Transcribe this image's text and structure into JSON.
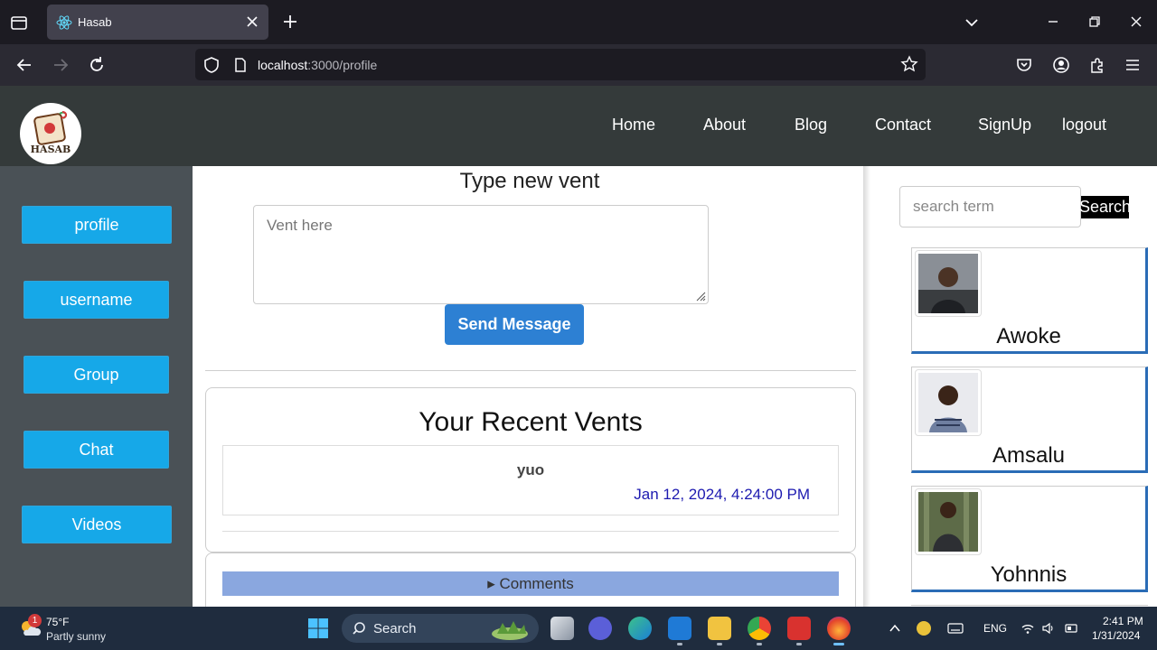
{
  "browser": {
    "tab_title": "Hasab",
    "url_host": "localhost",
    "url_path": ":3000/profile"
  },
  "site": {
    "logo_text": "HASAB",
    "nav": [
      "Home",
      "About",
      "Blog",
      "Contact",
      "SignUp",
      "logout"
    ]
  },
  "sidebar": {
    "items": [
      "profile",
      "username",
      "Group",
      "Chat",
      "Videos"
    ]
  },
  "vent_form": {
    "heading": "Type new vent",
    "placeholder": "Vent here",
    "send_label": "Send Message"
  },
  "recent": {
    "title": "Your Recent Vents",
    "vents": [
      {
        "text": "yuo",
        "date": "Jan 12, 2024, 4:24:00 PM"
      }
    ],
    "comments_label": "▸ Comments"
  },
  "search": {
    "placeholder": "search term",
    "button_label": "Search"
  },
  "users": [
    {
      "name": "Awoke"
    },
    {
      "name": "Amsalu"
    },
    {
      "name": "Yohnnis"
    }
  ],
  "taskbar": {
    "weather_temp": "75°F",
    "weather_desc": "Partly sunny",
    "weather_badge": "1",
    "search_label": "Search",
    "lang": "ENG",
    "time": "2:41 PM",
    "date": "1/31/2024"
  }
}
